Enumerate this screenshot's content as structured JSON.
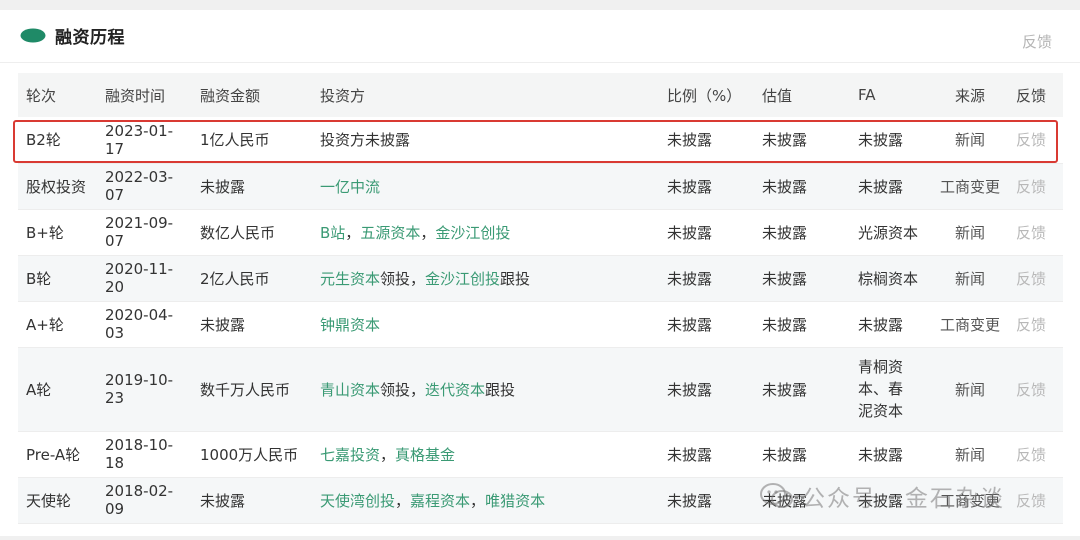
{
  "section": {
    "title": "融资历程",
    "feedback_label": "反馈"
  },
  "columns": [
    "轮次",
    "融资时间",
    "融资金额",
    "投资方",
    "比例（%）",
    "估值",
    "FA",
    "来源",
    "反馈"
  ],
  "rows": [
    {
      "round": "B2轮",
      "date": "2023-01-17",
      "amount": "1亿人民币",
      "investors": [
        {
          "text": "投资方未披露",
          "link": false
        }
      ],
      "ratio": "未披露",
      "valuation": "未披露",
      "fa": "未披露",
      "source": "新闻",
      "feedback": "反馈"
    },
    {
      "round": "股权投资",
      "date": "2022-03-07",
      "amount": "未披露",
      "investors": [
        {
          "text": "一亿中流",
          "link": true
        }
      ],
      "ratio": "未披露",
      "valuation": "未披露",
      "fa": "未披露",
      "source": "工商变更",
      "feedback": "反馈"
    },
    {
      "round": "B+轮",
      "date": "2021-09-07",
      "amount": "数亿人民币",
      "investors": [
        {
          "text": "B站",
          "link": true
        },
        {
          "text": "，",
          "link": false
        },
        {
          "text": "五源资本",
          "link": true
        },
        {
          "text": "，",
          "link": false
        },
        {
          "text": "金沙江创投",
          "link": true
        }
      ],
      "ratio": "未披露",
      "valuation": "未披露",
      "fa": "光源资本",
      "source": "新闻",
      "feedback": "反馈"
    },
    {
      "round": "B轮",
      "date": "2020-11-20",
      "amount": "2亿人民币",
      "investors": [
        {
          "text": "元生资本",
          "link": true
        },
        {
          "text": "领投，",
          "link": false
        },
        {
          "text": "金沙江创投",
          "link": true
        },
        {
          "text": "跟投",
          "link": false
        }
      ],
      "ratio": "未披露",
      "valuation": "未披露",
      "fa": "棕榈资本",
      "source": "新闻",
      "feedback": "反馈"
    },
    {
      "round": "A+轮",
      "date": "2020-04-03",
      "amount": "未披露",
      "investors": [
        {
          "text": "钟鼎资本",
          "link": true
        }
      ],
      "ratio": "未披露",
      "valuation": "未披露",
      "fa": "未披露",
      "source": "工商变更",
      "feedback": "反馈"
    },
    {
      "round": "A轮",
      "date": "2019-10-23",
      "amount": "数千万人民币",
      "investors": [
        {
          "text": "青山资本",
          "link": true
        },
        {
          "text": "领投，",
          "link": false
        },
        {
          "text": "迭代资本",
          "link": true
        },
        {
          "text": "跟投",
          "link": false
        }
      ],
      "ratio": "未披露",
      "valuation": "未披露",
      "fa": "青桐资本、春泥资本",
      "source": "新闻",
      "feedback": "反馈"
    },
    {
      "round": "Pre-A轮",
      "date": "2018-10-18",
      "amount": "1000万人民币",
      "investors": [
        {
          "text": "七嘉投资",
          "link": true
        },
        {
          "text": "，",
          "link": false
        },
        {
          "text": "真格基金",
          "link": true
        }
      ],
      "ratio": "未披露",
      "valuation": "未披露",
      "fa": "未披露",
      "source": "新闻",
      "feedback": "反馈"
    },
    {
      "round": "天使轮",
      "date": "2018-02-09",
      "amount": "未披露",
      "investors": [
        {
          "text": "天使湾创投",
          "link": true
        },
        {
          "text": "，",
          "link": false
        },
        {
          "text": "嘉程资本",
          "link": true
        },
        {
          "text": "，",
          "link": false
        },
        {
          "text": "唯猎资本",
          "link": true
        }
      ],
      "ratio": "未披露",
      "valuation": "未披露",
      "fa": "未披露",
      "source": "工商变更",
      "feedback": "反馈"
    }
  ],
  "highlighted_row": 0,
  "watermark": "公众号 · 金石杂谈",
  "colors": {
    "accent": "#3a9a74",
    "highlight_border": "#d93a33",
    "muted": "#b8b8b8"
  }
}
